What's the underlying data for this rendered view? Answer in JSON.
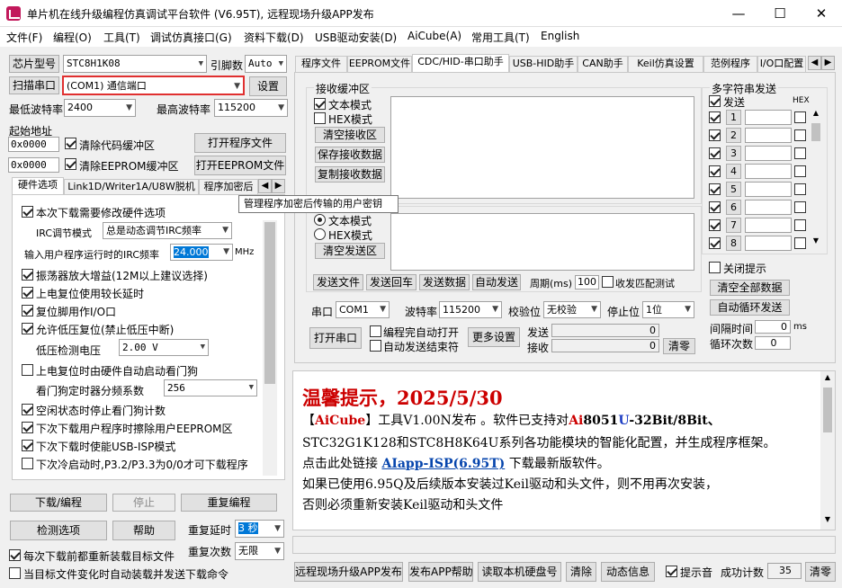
{
  "window": {
    "title": "单片机在线升级编程仿真调试平台软件 (V6.95T), 远程现场升级APP发布",
    "minimize_glyph": "—",
    "maximize_glyph": "☐",
    "close_glyph": "✕"
  },
  "menu": [
    "文件(F)",
    "编程(O)",
    "工具(T)",
    "调试仿真接口(G)",
    "资料下载(D)",
    "USB驱动安装(D)",
    "AiCube(A)",
    "常用工具(T)",
    "English"
  ],
  "left": {
    "chip_model_btn": "芯片型号",
    "chip_model": "STC8H1K08",
    "pin_count_label": "引脚数",
    "pin_count": "Auto",
    "scan_port_btn": "扫描串口",
    "port": "(COM1) 通信端口",
    "settings_btn": "设置",
    "min_baud_label": "最低波特率",
    "min_baud": "2400",
    "max_baud_label": "最高波特率",
    "max_baud": "115200",
    "start_addr_label": "起始地址",
    "addr1": "0x0000",
    "clear_code_buf": "清除代码缓冲区",
    "open_prog_btn": "打开程序文件",
    "addr2": "0x0000",
    "clear_eeprom_buf": "清除EEPROM缓冲区",
    "open_eeprom_btn": "打开EEPROM文件",
    "tabs": [
      "硬件选项",
      "Link1D/Writer1A/U8W脱机",
      "程序加密后"
    ],
    "tooltip": "管理程序加密后传输的用户密钥",
    "hw_options": {
      "modify_hw": "本次下载需要修改硬件选项",
      "irc_mode_label": "IRC调节模式",
      "irc_mode": "总是动态调节IRC频率",
      "irc_freq_label": "输入用户程序运行时的IRC频率",
      "irc_freq": "24.000",
      "irc_unit": "MHz",
      "osc_gain": "振荡器放大增益(12M以上建议选择)",
      "reset_delay": "上电复位使用较长延时",
      "reset_pin_io": "复位脚用作I/O口",
      "lvd_reset": "允许低压复位(禁止低压中断)",
      "lvd_label": "低压检测电压",
      "lvd_value": "2.00 V",
      "wdt_auto": "上电复位时由硬件自动启动看门狗",
      "wdt_div_label": "看门狗定时器分频系数",
      "wdt_div": "256",
      "idle_wdt": "空闲状态时停止看门狗计数",
      "erase_eeprom": "下次下载用户程序时擦除用户EEPROM区",
      "usb_isp": "下次下载时使能USB-ISP模式",
      "cold_boot": "下次冷启动时,P3.2/P3.3为0/0才可下载程序"
    },
    "download_btn": "下载/编程",
    "stop_btn": "停止",
    "reprogram_btn": "重复编程",
    "check_opts_btn": "检测选项",
    "help_btn": "帮助",
    "repeat_delay_label": "重复延时",
    "repeat_delay": "3 秒",
    "repeat_count_label": "重复次数",
    "repeat_count": "无限",
    "reload_each": "每次下载前都重新装载目标文件",
    "auto_reload": "当目标文件变化时自动装载并发送下载命令"
  },
  "right": {
    "tabs": [
      "程序文件",
      "EEPROM文件",
      "CDC/HID-串口助手",
      "USB-HID助手",
      "CAN助手",
      "Keil仿真设置",
      "范例程序",
      "I/O口配置"
    ],
    "rx_group": "接收缓冲区",
    "rx_text_mode": "文本模式",
    "rx_hex_mode": "HEX模式",
    "clear_rx": "清空接收区",
    "save_rx": "保存接收数据",
    "copy_rx": "复制接收数据",
    "tx_text_mode": "文本模式",
    "tx_hex_mode": "HEX模式",
    "clear_tx": "清空发送区",
    "send_file": "发送文件",
    "send_cr": "发送回车",
    "send_data": "发送数据",
    "auto_send": "自动发送",
    "period_label": "周期(ms)",
    "period": "100",
    "rx_match": "收发匹配测试",
    "port_label": "串口",
    "port": "COM1",
    "baud_label": "波特率",
    "baud": "115200",
    "parity_label": "校验位",
    "parity": "无校验",
    "stop_label": "停止位",
    "stop": "1位",
    "open_port": "打开串口",
    "auto_open": "编程完自动打开",
    "auto_end": "自动发送结束符",
    "more_settings": "更多设置",
    "send_label": "发送",
    "send_count": "0",
    "recv_label": "接收",
    "recv_count": "0",
    "clear_counts": "清零",
    "multi_group": "多字符串发送",
    "multi_send_label": "发送",
    "multi_hex": "HEX",
    "multi_rows": [
      "1",
      "2",
      "3",
      "4",
      "5",
      "6",
      "7",
      "8"
    ],
    "close_tips": "关闭提示",
    "clear_all": "清空全部数据",
    "auto_loop": "自动循环发送",
    "interval_label": "间隔时间",
    "interval": "0",
    "interval_unit": "ms",
    "loop_label": "循环次数",
    "loop_count": "0"
  },
  "notice": {
    "title": "温馨提示，2025/5/30",
    "l1_a": "【",
    "l1_b": "AiCube",
    "l1_c": "】工具V1.00N发布 。软件已支持对",
    "l1_d": "Ai",
    "l1_e": "8051",
    "l1_f": "U",
    "l1_g": "-32Bit/8Bit、",
    "l2": "STC32G1K128和STC8H8K64U系列各功能模块的智能化配置，并生成程序框架。",
    "l3_a": "点击此处链接 ",
    "l3_link": "AIapp-ISP(6.95T)",
    "l3_b": " 下载最新版软件。",
    "l4": "如果已使用6.95Q及后续版本安装过Keil驱动和头文件，则不用再次安装，",
    "l5": "否则必须重新安装Keil驱动和头文件"
  },
  "bottom": {
    "remote_btn": "远程现场升级APP发布",
    "publish_help": "发布APP帮助",
    "read_disk": "读取本机硬盘号",
    "clear": "清除",
    "dynamic_info": "动态信息",
    "beep": "提示音",
    "success_label": "成功计数",
    "success_count": "35",
    "clear_count": "清零"
  },
  "colors": {
    "accent_red": "#cc0000",
    "accent_blue": "#1f3fc4",
    "link": "#0645ad"
  }
}
